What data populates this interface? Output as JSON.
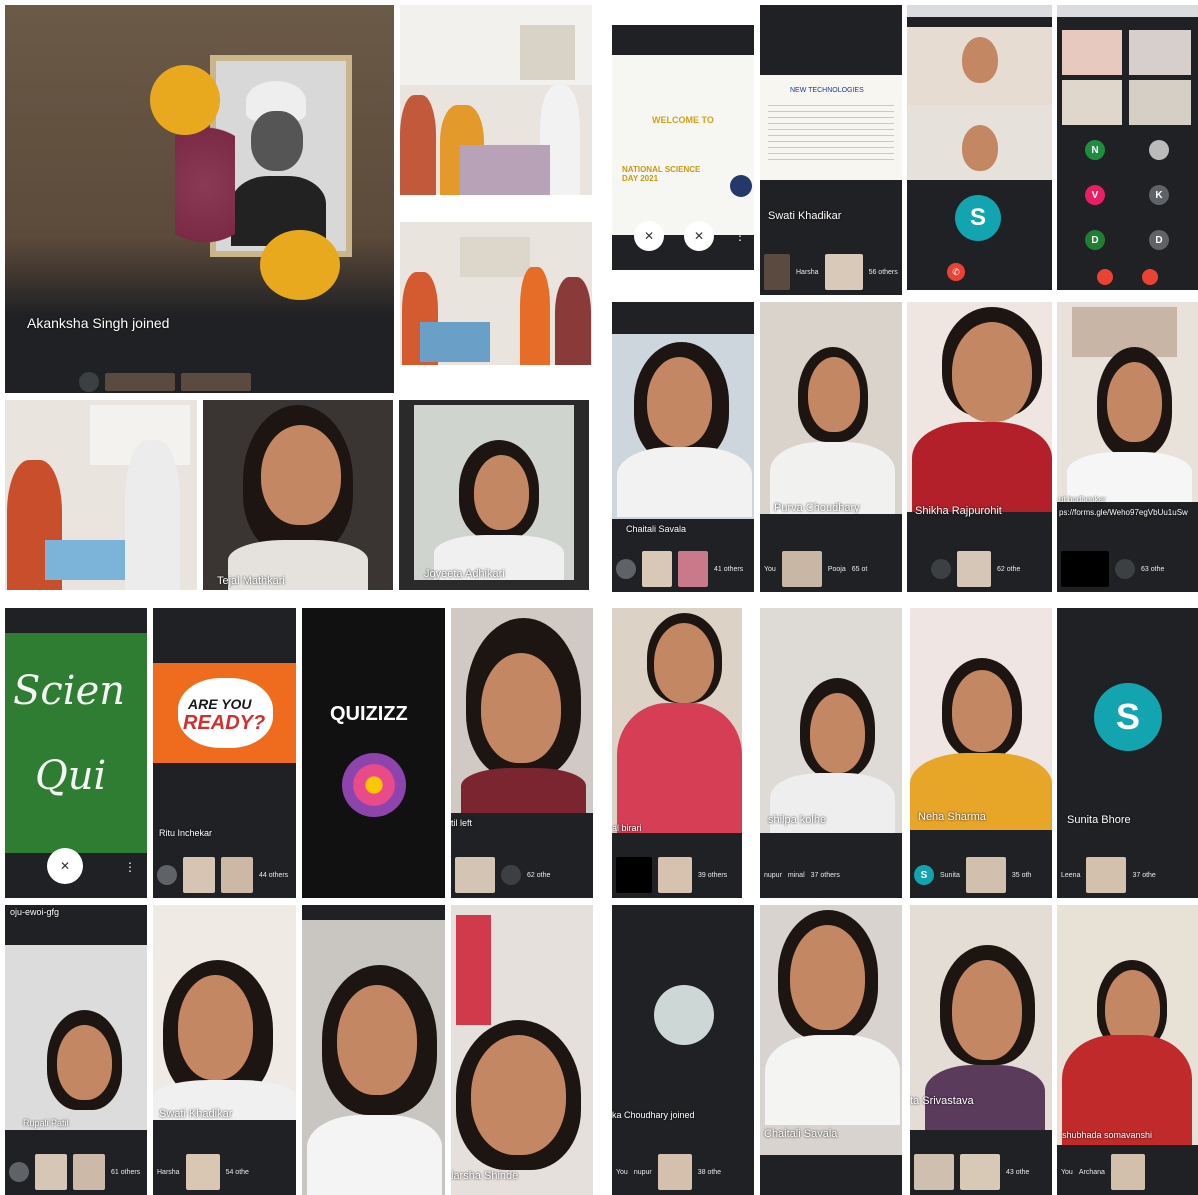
{
  "names": {
    "akanksha_joined": "Akanksha Singh joined",
    "tejal": "Tejal Mathkari",
    "joyeeta": "Joyeeta Adhikari",
    "swati_top": "Swati Khadikar",
    "chaitali_top": "Chaitali Savala",
    "purva": "Purva Choudhary",
    "shikha": "Shikha Rajpurohit",
    "forms_link": "ps://forms.gle/Weho97egVbUu1uSw",
    "bodhenkar": "ut bodhenkar",
    "ritu": "Ritu Inchekar",
    "til_left": "til left",
    "al_birari": "al birari",
    "shilpa": "shilpa kolhe",
    "neha": "Neha Sharma",
    "sunita": "Sunita Bhore",
    "meet_code": "oju-ewoi-gfg",
    "rupali": "Rupali Patil",
    "swati_bottom": "Swati Khadikar",
    "harsha_shinde": "larsha Shinde",
    "choudhary_joined": "ka Choudhary joined",
    "chaitali_bottom": "Chaitali Savala",
    "srivastava": "ta Srivastava",
    "shubhada": "shubhada somavanshi"
  },
  "slides": {
    "welcome": "WELCOME TO",
    "nsd": "NATIONAL SCIENCE DAY 2021",
    "new_tech": "NEW TECHNOLOGIES",
    "science_quiz_1": "Scien",
    "science_quiz_2": "Qui",
    "are_you": "ARE YOU",
    "ready": "READY?",
    "quizizz": "QUIZIZZ"
  },
  "participants_bar": {
    "harsha": "Harsha",
    "others_56": "56 others",
    "you": "You",
    "pooja": "Pooja",
    "others_65": "65 ot",
    "others_62": "62 othe",
    "others_63": "63 othe",
    "others_41": "41 others",
    "others_44": "44 others",
    "others_62b": "62 othe",
    "others_39": "39 others",
    "nupur": "nupur",
    "minal": "minal",
    "others_37": "37 others",
    "sunita_s": "Sunita",
    "others_35": "35 oth",
    "leena": "Leena",
    "others_37b": "37 othe",
    "others_61": "61 others",
    "others_54": "54 othe",
    "others_38": "38 othe",
    "others_43": "43 othe",
    "archana": "Archana"
  },
  "avatars": {
    "s": "S",
    "n": "N",
    "v": "V",
    "k": "K",
    "d": "D"
  },
  "colors": {
    "meet_dark": "#202124",
    "avatar_teal": "#12a4af",
    "end_call_red": "#ea4335"
  }
}
